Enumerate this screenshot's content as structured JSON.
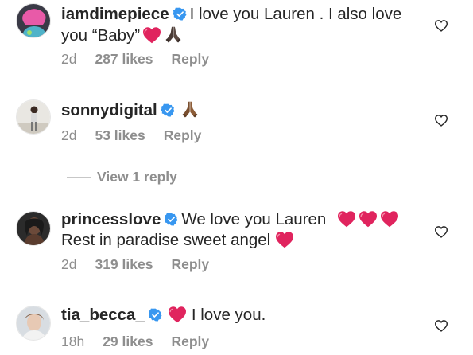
{
  "colors": {
    "text": "#262626",
    "meta": "#8e8e8e",
    "verified": "#3897f0",
    "heart": "#e0245e"
  },
  "comments": [
    {
      "username": "iamdimepiece",
      "text": "I love you Lauren . I also love you “Baby”",
      "emojis": [
        "heart-emoji",
        "praying-hands-emoji"
      ],
      "age": "2d",
      "likes": "287 likes",
      "reply": "Reply"
    },
    {
      "username": "sonnydigital",
      "text": "",
      "emojis": [
        "praying-hands-emoji"
      ],
      "age": "2d",
      "likes": "53 likes",
      "reply": "Reply"
    },
    {
      "username": "princesslove",
      "text_line1": "We love you Lauren",
      "text_line2": "Rest in paradise sweet angel",
      "emojis": [
        "heart-emoji",
        "heart-emoji",
        "heart-emoji",
        "heart-emoji"
      ],
      "age": "2d",
      "likes": "319 likes",
      "reply": "Reply"
    },
    {
      "username": "tia_becca_",
      "text": "I love you.",
      "emojis": [
        "heart-emoji"
      ],
      "age": "18h",
      "likes": "29 likes",
      "reply": "Reply"
    }
  ],
  "view_replies": "View 1 reply"
}
